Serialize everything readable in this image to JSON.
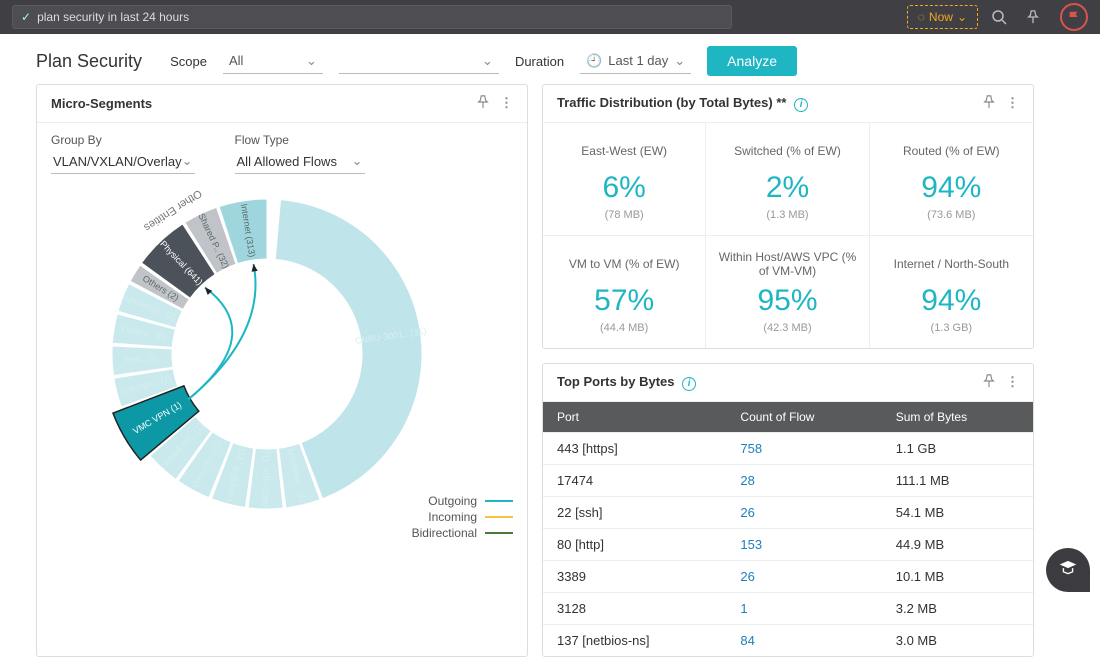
{
  "topbar": {
    "search_text": "plan security in last 24 hours",
    "now_label": "Now"
  },
  "toolbar": {
    "page_title": "Plan Security",
    "scope_label": "Scope",
    "scope_value": "All",
    "scope2_value": "",
    "duration_label": "Duration",
    "duration_value": "Last 1 day",
    "analyze_label": "Analyze"
  },
  "micro_segments": {
    "title": "Micro-Segments",
    "group_by_label": "Group By",
    "group_by_value": "VLAN/VXLAN/Overlay",
    "flow_type_label": "Flow Type",
    "flow_type_value": "All Allowed Flows",
    "legend": {
      "outgoing": "Outgoing",
      "incoming": "Incoming",
      "bidirectional": "Bidirectional"
    },
    "colors": {
      "outgoing": "#1fb6c4",
      "incoming": "#f5c542",
      "bidirectional": "#4a7a3a"
    },
    "arcs": [
      {
        "label": "CNBU-3001.. (31)",
        "color": "#bfe5ea"
      },
      {
        "label": "Universa.. (2)",
        "color": "#c9e9ec"
      },
      {
        "label": "sddc-cgw.. (1)",
        "color": "#c9e9ec"
      },
      {
        "label": "compB-fr.. (1)",
        "color": "#c9e9ec"
      },
      {
        "label": "vms-nsx.. (1)",
        "color": "#c9e9ec"
      },
      {
        "label": "compA-co.. (1)",
        "color": "#c9e9ec"
      },
      {
        "label": "VMC VPN (1)",
        "color": "#0d98a6",
        "highlight": true
      },
      {
        "label": "mgt-cgw.. (1)",
        "color": "#c9e9ec"
      },
      {
        "label": "test.. (2)",
        "color": "#c9e9ec"
      },
      {
        "label": "Others.. (6)",
        "color": "#c9e9ec"
      },
      {
        "label": "Universa.. (2)",
        "color": "#c9e9ec"
      },
      {
        "label": "Others (2)",
        "color": "#c0c3c7"
      },
      {
        "label": "Physical (641)",
        "color": "#4c5259"
      },
      {
        "label": "Shared P.. (32)",
        "color": "#c0c3c7"
      },
      {
        "label": "Internet (313)",
        "color": "#9fd6de"
      }
    ],
    "other_entities_label": "Other Entities"
  },
  "traffic": {
    "title": "Traffic Distribution (by Total Bytes) **",
    "cells": [
      {
        "label": "East-West (EW)",
        "value": "6%",
        "sub": "(78 MB)"
      },
      {
        "label": "Switched (% of EW)",
        "value": "2%",
        "sub": "(1.3 MB)"
      },
      {
        "label": "Routed (% of EW)",
        "value": "94%",
        "sub": "(73.6 MB)"
      },
      {
        "label": "VM to VM (% of EW)",
        "value": "57%",
        "sub": "(44.4 MB)"
      },
      {
        "label": "Within Host/AWS VPC (% of VM-VM)",
        "value": "95%",
        "sub": "(42.3 MB)"
      },
      {
        "label": "Internet / North-South",
        "value": "94%",
        "sub": "(1.3 GB)"
      }
    ]
  },
  "ports": {
    "title": "Top Ports by Bytes",
    "columns": [
      "Port",
      "Count of Flow",
      "Sum of Bytes"
    ],
    "rows": [
      {
        "port": "443 [https]",
        "count": "758",
        "bytes": "1.1 GB"
      },
      {
        "port": "17474",
        "count": "28",
        "bytes": "111.1 MB"
      },
      {
        "port": "22 [ssh]",
        "count": "26",
        "bytes": "54.1 MB"
      },
      {
        "port": "80 [http]",
        "count": "153",
        "bytes": "44.9 MB"
      },
      {
        "port": "3389",
        "count": "26",
        "bytes": "10.1 MB"
      },
      {
        "port": "3128",
        "count": "1",
        "bytes": "3.2 MB"
      },
      {
        "port": "137 [netbios-ns]",
        "count": "84",
        "bytes": "3.0 MB"
      }
    ]
  },
  "chart_data": {
    "type": "chord",
    "title": "Micro-Segments",
    "group_by": "VLAN/VXLAN/Overlay",
    "flow_type": "All Allowed Flows",
    "nodes": [
      {
        "name": "CNBU-3001..",
        "count": 31
      },
      {
        "name": "Universa..",
        "count": 2
      },
      {
        "name": "sddc-cgw..",
        "count": 1
      },
      {
        "name": "compB-fr..",
        "count": 1
      },
      {
        "name": "vms-nsx..",
        "count": 1
      },
      {
        "name": "compA-co..",
        "count": 1
      },
      {
        "name": "VMC VPN",
        "count": 1,
        "selected": true
      },
      {
        "name": "mgt-cgw..",
        "count": 1
      },
      {
        "name": "test..",
        "count": 2
      },
      {
        "name": "Others..",
        "count": 6
      },
      {
        "name": "Universa..",
        "count": 2
      },
      {
        "name": "Others",
        "count": 2,
        "group": "other"
      },
      {
        "name": "Physical",
        "count": 641,
        "group": "other"
      },
      {
        "name": "Shared P..",
        "count": 32,
        "group": "other"
      },
      {
        "name": "Internet",
        "count": 313,
        "group": "other"
      }
    ],
    "links": [
      {
        "source": "VMC VPN",
        "target": "Internet",
        "direction": "outgoing"
      },
      {
        "source": "VMC VPN",
        "target": "Physical",
        "direction": "outgoing"
      }
    ]
  }
}
